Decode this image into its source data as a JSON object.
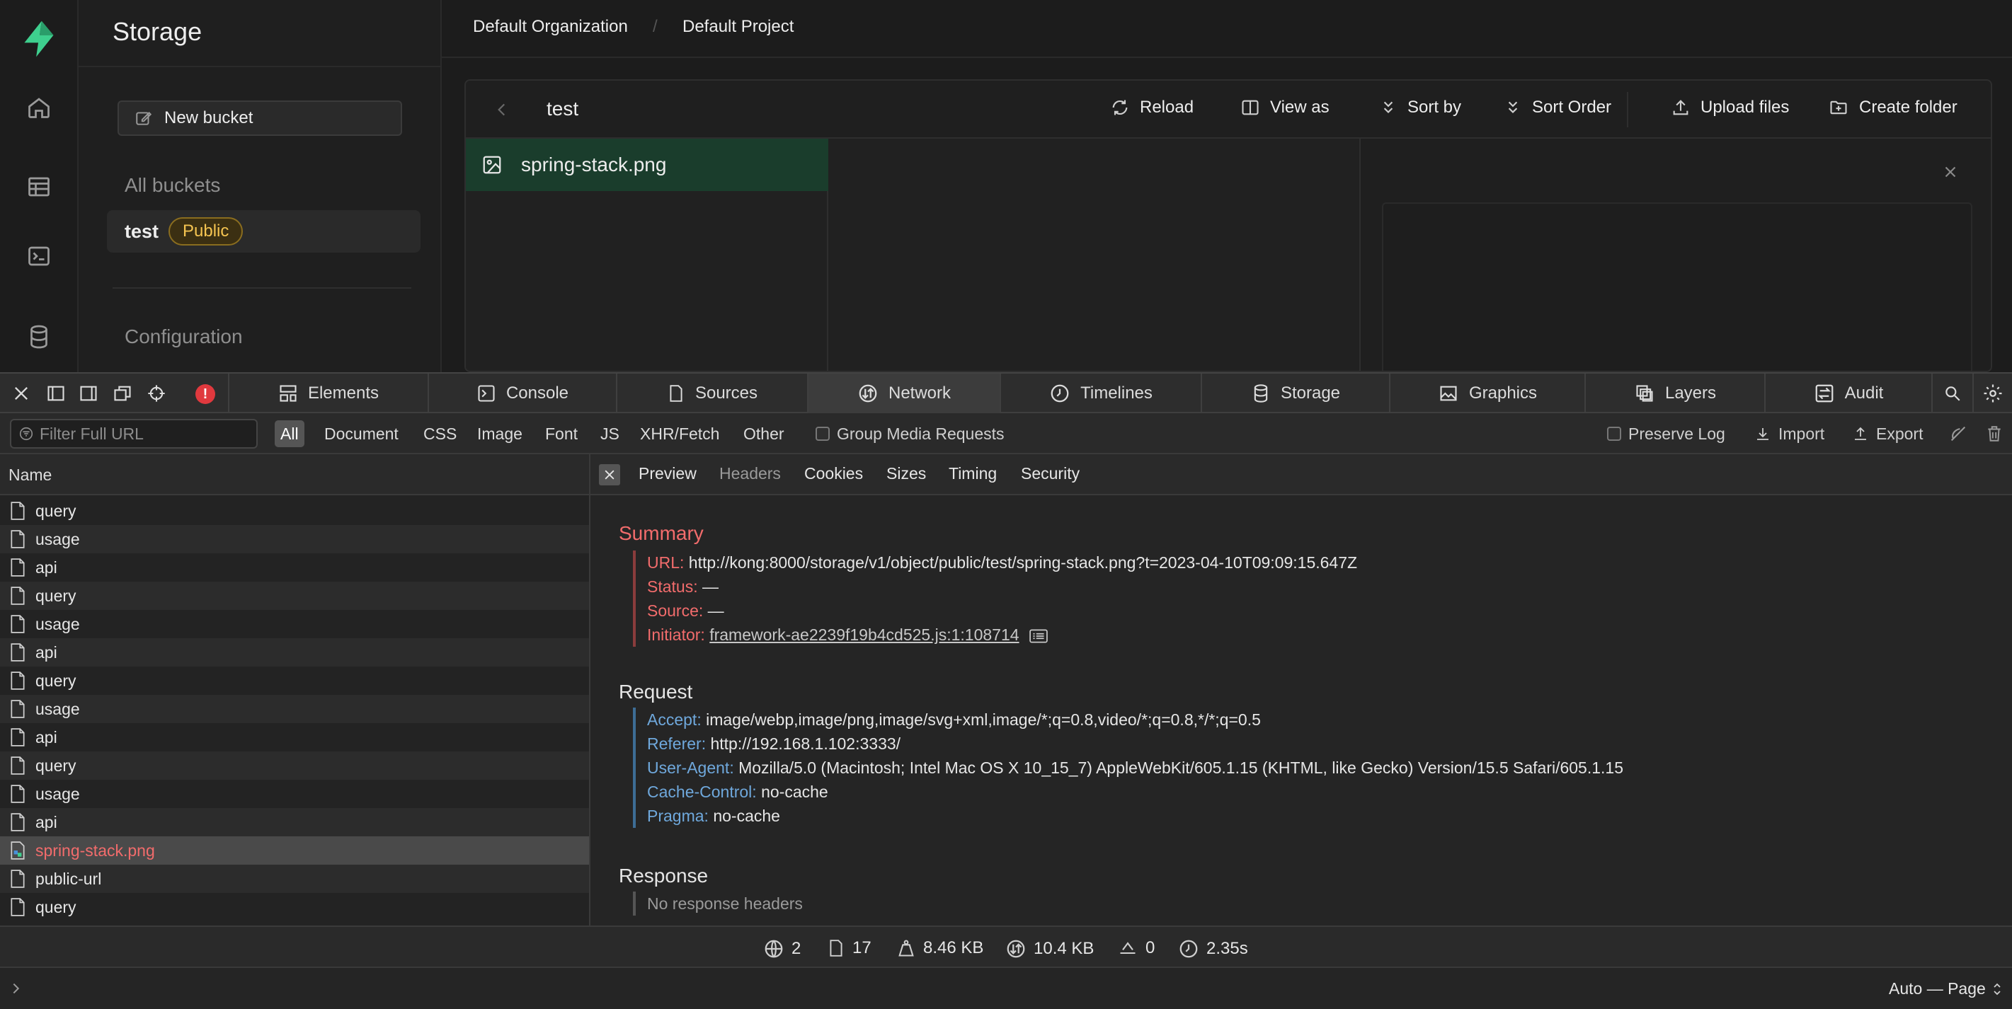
{
  "app": {
    "section_title": "Storage",
    "new_bucket_label": "New bucket",
    "all_buckets_label": "All buckets",
    "bucket": {
      "name": "test",
      "badge": "Public"
    },
    "configuration_label": "Configuration",
    "breadcrumb": {
      "org": "Default Organization",
      "separator": "/",
      "project": "Default Project"
    },
    "explorer": {
      "path": "test",
      "toolbar": {
        "reload": "Reload",
        "view_as": "View as",
        "sort_by": "Sort by",
        "sort_order": "Sort Order",
        "upload_files": "Upload files",
        "create_folder": "Create folder"
      },
      "selected_file": "spring-stack.png"
    },
    "colors": {
      "brand": "#3ecf8e",
      "selected_row": "#1a3d2c",
      "badge": "#f5c451"
    }
  },
  "devtools": {
    "tabs": {
      "elements": "Elements",
      "console": "Console",
      "sources": "Sources",
      "network": "Network",
      "timelines": "Timelines",
      "storage": "Storage",
      "graphics": "Graphics",
      "layers": "Layers",
      "audit": "Audit"
    },
    "error_badge": "!",
    "filter": {
      "placeholder": "Filter Full URL",
      "types": {
        "all": "All",
        "document": "Document",
        "css": "CSS",
        "image": "Image",
        "font": "Font",
        "js": "JS",
        "xhr": "XHR/Fetch",
        "other": "Other"
      },
      "group_media": "Group Media Requests",
      "preserve_log": "Preserve Log",
      "import": "Import",
      "export": "Export"
    },
    "list_header": "Name",
    "requests": [
      {
        "name": "query"
      },
      {
        "name": "usage"
      },
      {
        "name": "api"
      },
      {
        "name": "query"
      },
      {
        "name": "usage"
      },
      {
        "name": "api"
      },
      {
        "name": "query"
      },
      {
        "name": "usage"
      },
      {
        "name": "api"
      },
      {
        "name": "query"
      },
      {
        "name": "usage"
      },
      {
        "name": "api"
      },
      {
        "name": "spring-stack.png"
      },
      {
        "name": "public-url"
      },
      {
        "name": "query"
      }
    ],
    "detail_tabs": {
      "preview": "Preview",
      "headers": "Headers",
      "cookies": "Cookies",
      "sizes": "Sizes",
      "timing": "Timing",
      "security": "Security"
    },
    "summary": {
      "title": "Summary",
      "url_key": "URL:",
      "url_val": "http://kong:8000/storage/v1/object/public/test/spring-stack.png?t=2023-04-10T09:09:15.647Z",
      "status_key": "Status:",
      "status_val": "—",
      "source_key": "Source:",
      "source_val": "—",
      "initiator_key": "Initiator:",
      "initiator_val": "framework-ae2239f19b4cd525.js:1:108714"
    },
    "request": {
      "title": "Request",
      "accept_key": "Accept:",
      "accept_val": "image/webp,image/png,image/svg+xml,image/*;q=0.8,video/*;q=0.8,*/*;q=0.5",
      "referer_key": "Referer:",
      "referer_val": "http://192.168.1.102:3333/",
      "ua_key": "User-Agent:",
      "ua_val": "Mozilla/5.0 (Macintosh; Intel Mac OS X 10_15_7) AppleWebKit/605.1.15 (KHTML, like Gecko) Version/15.5 Safari/605.1.15",
      "cache_key": "Cache-Control:",
      "cache_val": "no-cache",
      "pragma_key": "Pragma:",
      "pragma_val": "no-cache"
    },
    "response": {
      "title": "Response",
      "empty": "No response headers"
    },
    "status": {
      "domains": "2",
      "requests": "17",
      "transferred": "8.46 KB",
      "resources": "10.4 KB",
      "redirects": "0",
      "time": "2.35s"
    },
    "console_scope": "Auto — Page",
    "colors": {
      "red_key": "#f26c6c",
      "blue_key": "#6fa8dc"
    }
  }
}
